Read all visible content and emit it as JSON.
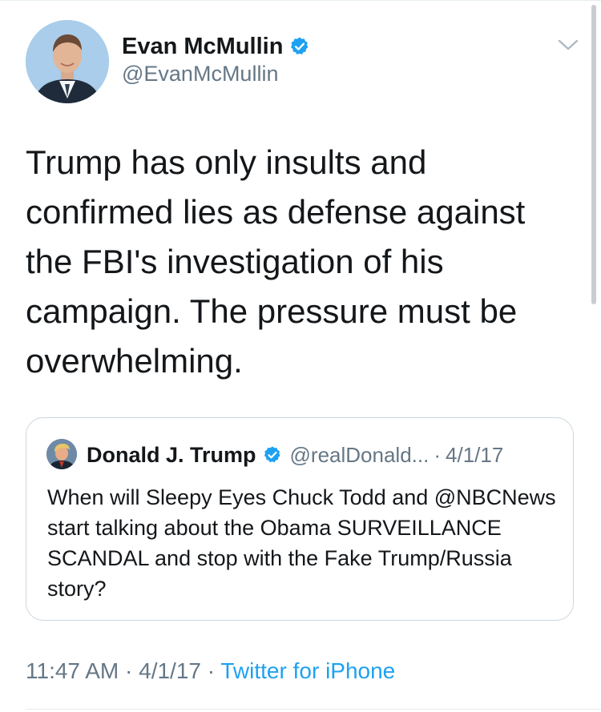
{
  "tweet": {
    "author_name": "Evan McMullin",
    "author_handle": "@EvanMcMullin",
    "text": "Trump has only insults and confirmed lies as defense against the FBI's investigation of his campaign. The pressure must be overwhelming.",
    "time": "11:47 AM",
    "date": "4/1/17",
    "source": "Twitter for iPhone",
    "separator": "·",
    "verified_icon": "verified-badge-icon",
    "menu_icon": "chevron-down-icon"
  },
  "quoted_tweet": {
    "author_name": "Donald J. Trump",
    "author_handle": "@realDonald...",
    "separator": "·",
    "date": "4/1/17",
    "text": "When will Sleepy Eyes Chuck Todd and @NBCNews start talking about the Obama SURVEILLANCE SCANDAL and stop with the Fake Trump/Russia story?"
  },
  "colors": {
    "accent": "#1da1f2",
    "secondary_text": "#657786",
    "primary_text": "#14171a",
    "border": "#ccd6dd"
  }
}
